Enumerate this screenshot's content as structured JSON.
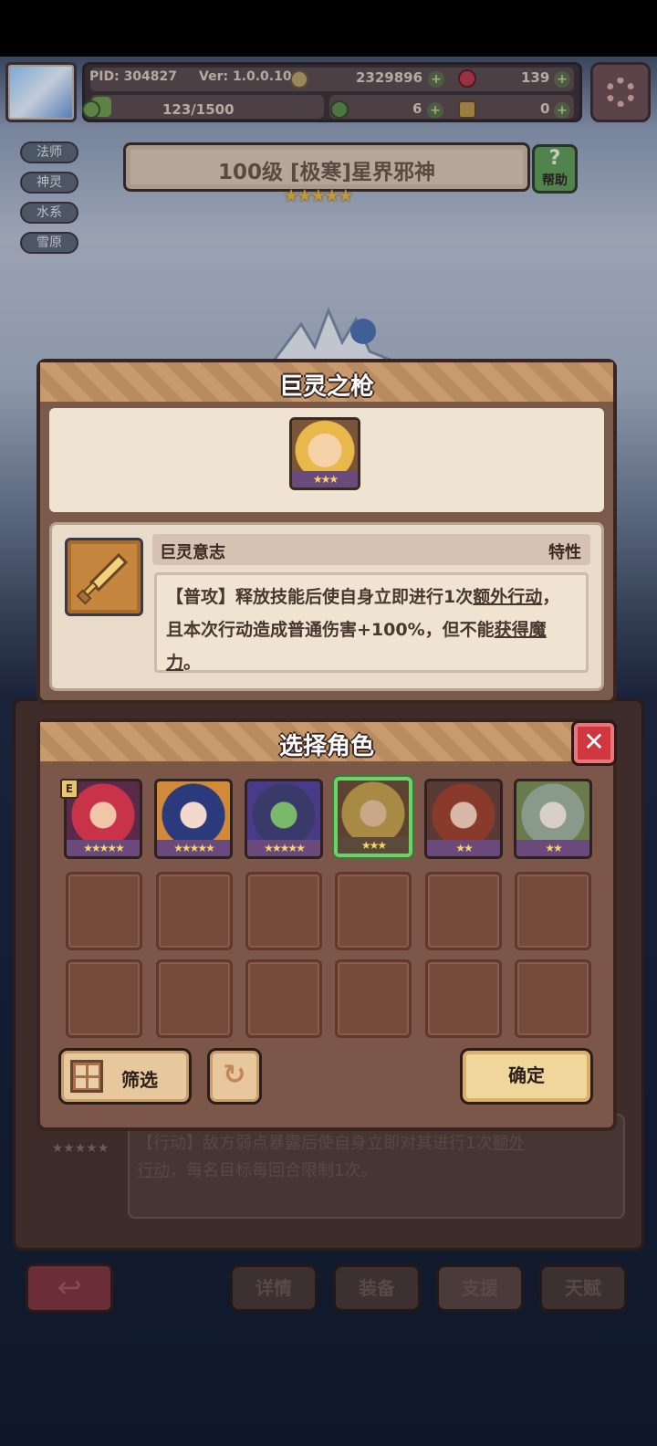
{
  "header": {
    "pid": "PID: 304827",
    "version": "Ver: 1.0.0.10",
    "gold": "2329896",
    "gems": "139",
    "stamina": "123/1500",
    "clover": "6",
    "keys": "0",
    "stamina_level": 0.082
  },
  "tags": [
    "法师",
    "神灵",
    "水系",
    "雪原"
  ],
  "boss": {
    "title": "100级  [极寒]星界邪神",
    "stars": "★★★★★",
    "help_label": "帮助",
    "help_icon": "?"
  },
  "skill_modal": {
    "title": "巨灵之枪",
    "portrait_stars": "★★★",
    "trait_name": "巨灵意志",
    "trait_kind": "特性",
    "desc_prefix": "【普攻】释放技能后使自身立即进行1次",
    "desc_link1": "额外行动",
    "desc_mid": "，且本次行动造成普通伤害+100%，但不能",
    "desc_link2": "获得魔力",
    "desc_suffix": "。"
  },
  "select_modal": {
    "title": "选择角色",
    "close_icon": "✕",
    "heroes": [
      {
        "stars": "★★★★★",
        "badge": "E"
      },
      {
        "stars": "★★★★★"
      },
      {
        "stars": "★★★★★"
      },
      {
        "stars": "★★★"
      },
      {
        "stars": "★★"
      },
      {
        "stars": "★★"
      }
    ],
    "filter_label": "筛选",
    "refresh_icon": "↻",
    "confirm_label": "确定"
  },
  "background": {
    "desc_line1": "【行动】敌方弱点暴露后使自身立即对其进行1次",
    "desc_link": "额外",
    "desc_line2a": "行动",
    "desc_line2b": "，每名目标每回合限制1次。",
    "stars": "★★★★★"
  },
  "nav": {
    "back_icon": "↩",
    "details": "详情",
    "equip": "装备",
    "support": "支援",
    "talent": "天赋"
  }
}
